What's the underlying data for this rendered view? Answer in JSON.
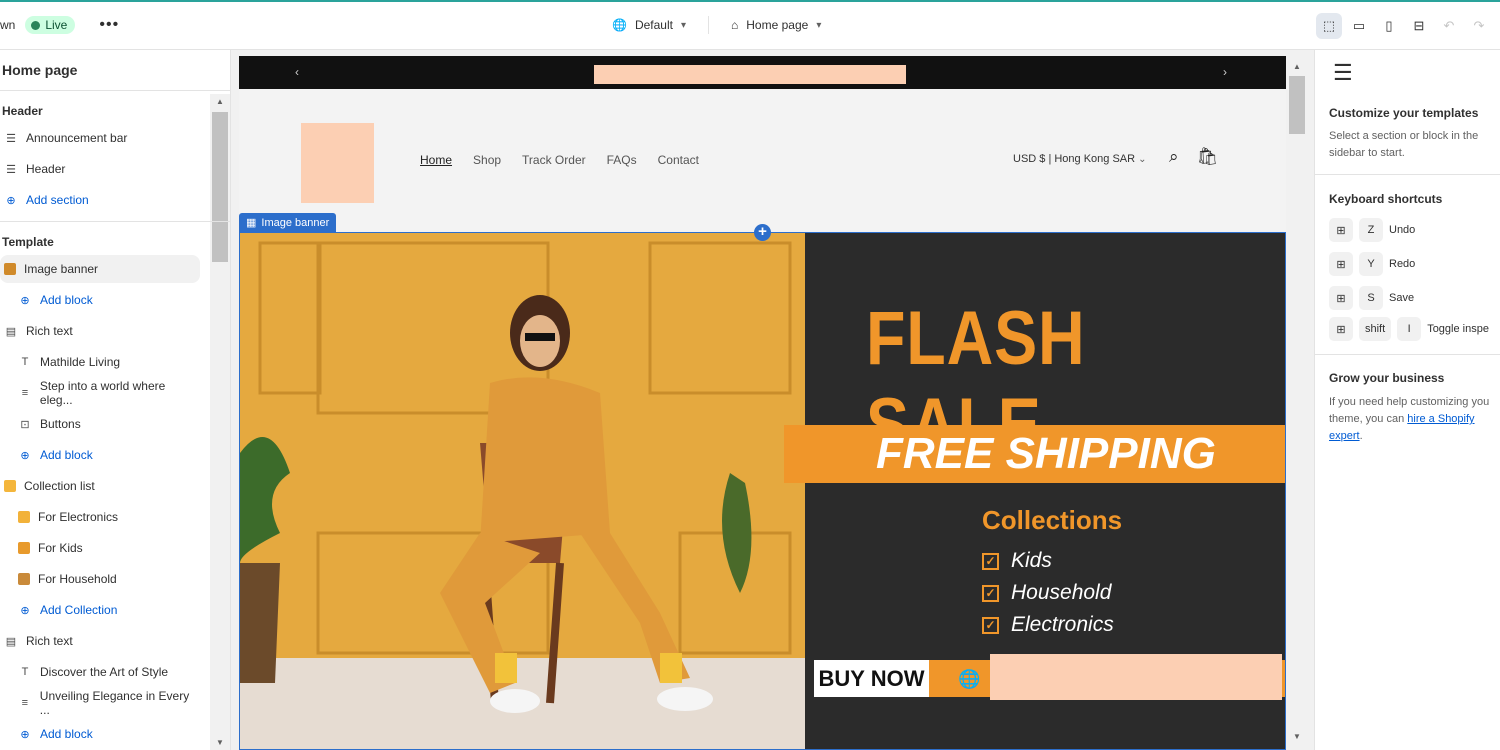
{
  "topbar": {
    "theme_name_fragment": "wn",
    "status": "Live",
    "more": "•••",
    "theme_select": "Default",
    "page_select": "Home page"
  },
  "sidebar": {
    "title": "Home page",
    "header_group": "Header",
    "header_items": [
      {
        "label": "Announcement bar"
      },
      {
        "label": "Header"
      },
      {
        "label": "Add section"
      }
    ],
    "template_group": "Template",
    "template_items": [
      {
        "label": "Image banner"
      },
      {
        "label": "Add block"
      },
      {
        "label": "Rich text"
      },
      {
        "label": "Mathilde Living"
      },
      {
        "label": "Step into a world where eleg..."
      },
      {
        "label": "Buttons"
      },
      {
        "label": "Add block"
      },
      {
        "label": "Collection list"
      },
      {
        "label": "For Electronics"
      },
      {
        "label": "For Kids"
      },
      {
        "label": "For Household"
      },
      {
        "label": "Add Collection"
      },
      {
        "label": "Rich text"
      },
      {
        "label": "Discover the Art of Style"
      },
      {
        "label": "Unveiling Elegance in Every ..."
      },
      {
        "label": "Add block"
      }
    ]
  },
  "preview": {
    "nav": [
      "Home",
      "Shop",
      "Track Order",
      "FAQs",
      "Contact"
    ],
    "currency": "USD $ | Hong Kong SAR",
    "section_badge": "Image banner",
    "banner": {
      "headline": "FLASH SALE",
      "subheadline": "FREE SHIPPING",
      "collections_title": "Collections",
      "collections": [
        "Kids",
        "Household",
        "Electronics"
      ],
      "cta": "BUY NOW"
    }
  },
  "inspector": {
    "customize_title": "Customize your templates",
    "customize_text": "Select a section or block in the sidebar to start.",
    "shortcuts_title": "Keyboard shortcuts",
    "shortcuts": [
      {
        "keys": [
          "Z"
        ],
        "action": "Undo"
      },
      {
        "keys": [
          "Y"
        ],
        "action": "Redo"
      },
      {
        "keys": [
          "S"
        ],
        "action": "Save"
      },
      {
        "keys": [
          "shift",
          "I"
        ],
        "action": "Toggle inspe"
      }
    ],
    "grow_title": "Grow your business",
    "grow_text_1": "If you need help customizing you",
    "grow_text_2": "theme, you can ",
    "grow_link": "hire a Shopify expert",
    "grow_text_3": "."
  },
  "colors": {
    "accent": "#005bd3",
    "banner_orange": "#f0962a",
    "banner_dark": "#2b2b2b",
    "placeholder": "#fccfb3"
  }
}
